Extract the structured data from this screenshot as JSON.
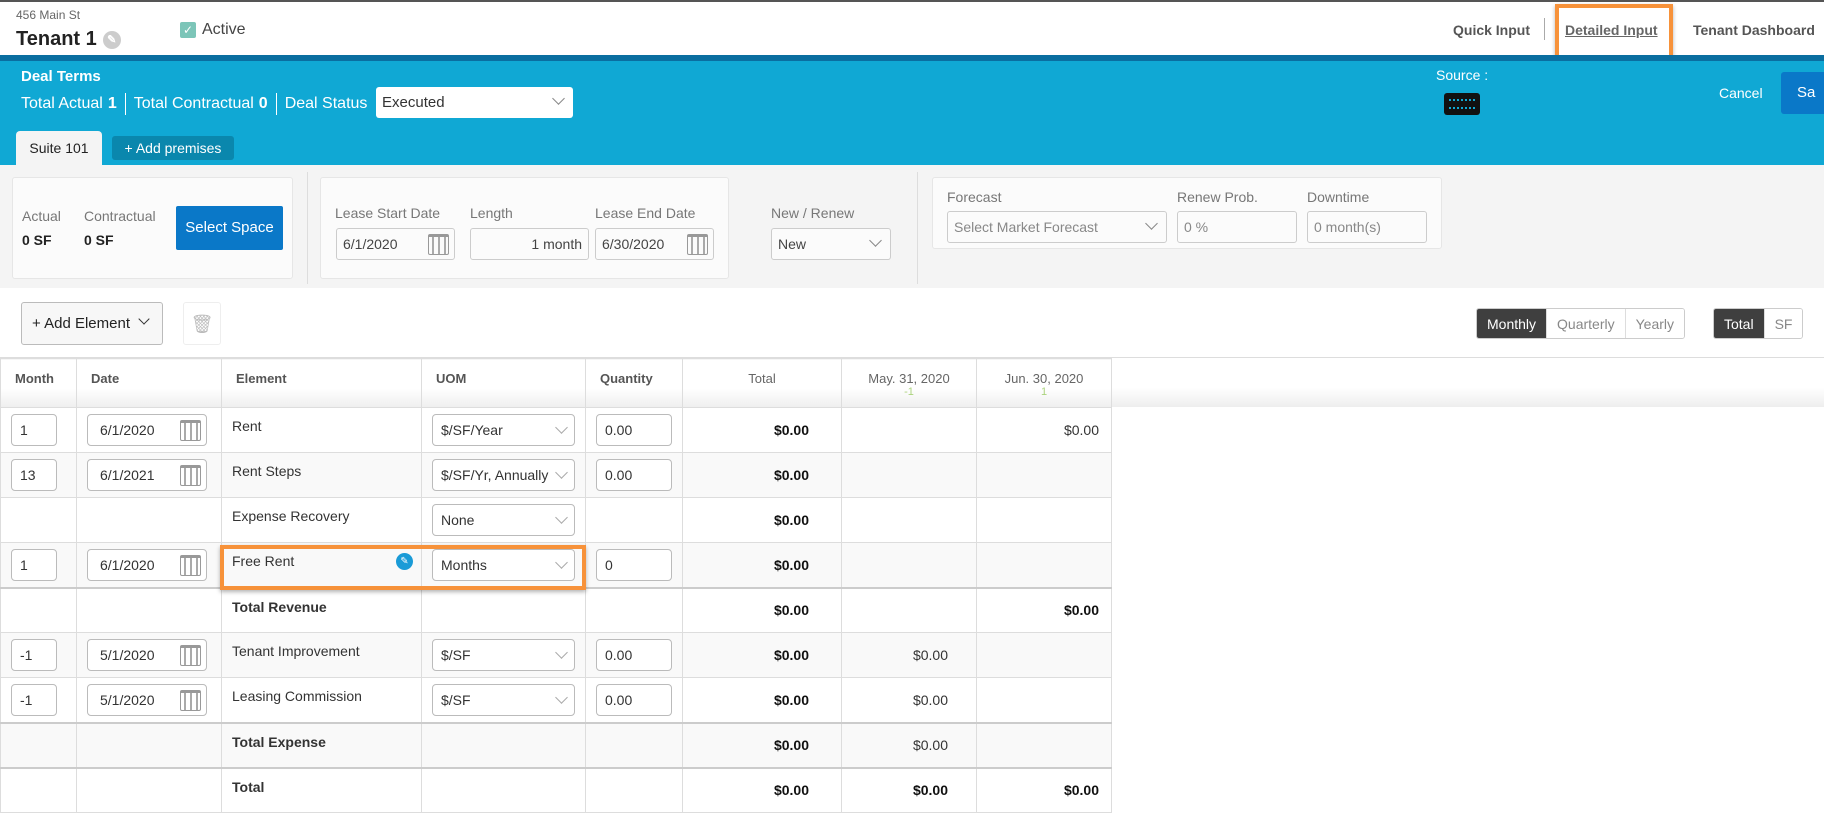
{
  "header": {
    "address": "456 Main St",
    "tenant": "Tenant 1",
    "active_label": "Active",
    "active_checked": true,
    "nav": [
      "Quick Input",
      "Detailed Input",
      "Tenant Dashboard"
    ],
    "nav_selected": "Detailed Input"
  },
  "deal": {
    "title": "Deal Terms",
    "total_actual_label": "Total Actual",
    "total_actual": "1",
    "total_contractual_label": "Total Contractual",
    "total_contractual": "0",
    "status_label": "Deal Status",
    "status": "Executed",
    "source_label": "Source :",
    "source_icon": "keyboard-icon",
    "cancel": "Cancel",
    "save": "Sa"
  },
  "tabs": {
    "suite": "Suite 101",
    "add": "+ Add premises"
  },
  "space": {
    "actual_label": "Actual",
    "actual": "0 SF",
    "contractual_label": "Contractual",
    "contractual": "0 SF",
    "select": "Select Space"
  },
  "lease": {
    "start_label": "Lease Start Date",
    "start": "6/1/2020",
    "length_label": "Length",
    "length": "1 month",
    "end_label": "Lease End Date",
    "end": "6/30/2020"
  },
  "renew": {
    "label": "New / Renew",
    "value": "New"
  },
  "forecast": {
    "label": "Forecast",
    "placeholder": "Select Market Forecast",
    "prob_label": "Renew Prob.",
    "prob": "0 %",
    "down_label": "Downtime",
    "down": "0 month(s)"
  },
  "toolbar": {
    "add": "+ Add Element",
    "period": [
      "Monthly",
      "Quarterly",
      "Yearly"
    ],
    "period_selected": "Monthly",
    "basis": [
      "Total",
      "SF"
    ],
    "basis_selected": "Total"
  },
  "table": {
    "headers": [
      "Month",
      "Date",
      "Element",
      "UOM",
      "Quantity",
      "Total",
      "May. 31, 2020",
      "Jun. 30, 2020"
    ],
    "sub": {
      "may": "-1",
      "jun": "1"
    },
    "rows": [
      {
        "month": "1",
        "date": "6/1/2020",
        "element": "Rent",
        "uom": "$/SF/Year",
        "qty": "0.00",
        "total": "$0.00",
        "may": "",
        "jun": "$0.00"
      },
      {
        "month": "13",
        "date": "6/1/2021",
        "element": "Rent Steps",
        "uom": "$/SF/Yr, Annually",
        "qty": "0.00",
        "total": "$0.00",
        "may": "",
        "jun": ""
      },
      {
        "month": "",
        "date": "",
        "element": "Expense Recovery",
        "uom": "None",
        "qty": "",
        "total": "$0.00",
        "may": "",
        "jun": ""
      },
      {
        "month": "1",
        "date": "6/1/2020",
        "element": "Free Rent",
        "uom": "Months",
        "qty": "0",
        "total": "$0.00",
        "may": "",
        "jun": "",
        "edit": true
      },
      {
        "element": "Total Revenue",
        "total": "$0.00",
        "may": "",
        "jun": "$0.00",
        "sum": true
      },
      {
        "month": "-1",
        "date": "5/1/2020",
        "element": "Tenant Improvement",
        "uom": "$/SF",
        "qty": "0.00",
        "total": "$0.00",
        "may": "$0.00",
        "jun": ""
      },
      {
        "month": "-1",
        "date": "5/1/2020",
        "element": "Leasing Commission",
        "uom": "$/SF",
        "qty": "0.00",
        "total": "$0.00",
        "may": "$0.00",
        "jun": ""
      },
      {
        "element": "Total Expense",
        "total": "$0.00",
        "may": "$0.00",
        "jun": "",
        "sum": true
      },
      {
        "element": "Total",
        "total": "$0.00",
        "may": "$0.00",
        "jun": "$0.00",
        "sum": true,
        "boldall": true
      }
    ]
  },
  "colors": {
    "accent": "#10a8d4",
    "highlight": "#f7923a",
    "primary_button": "#0a78c8"
  }
}
